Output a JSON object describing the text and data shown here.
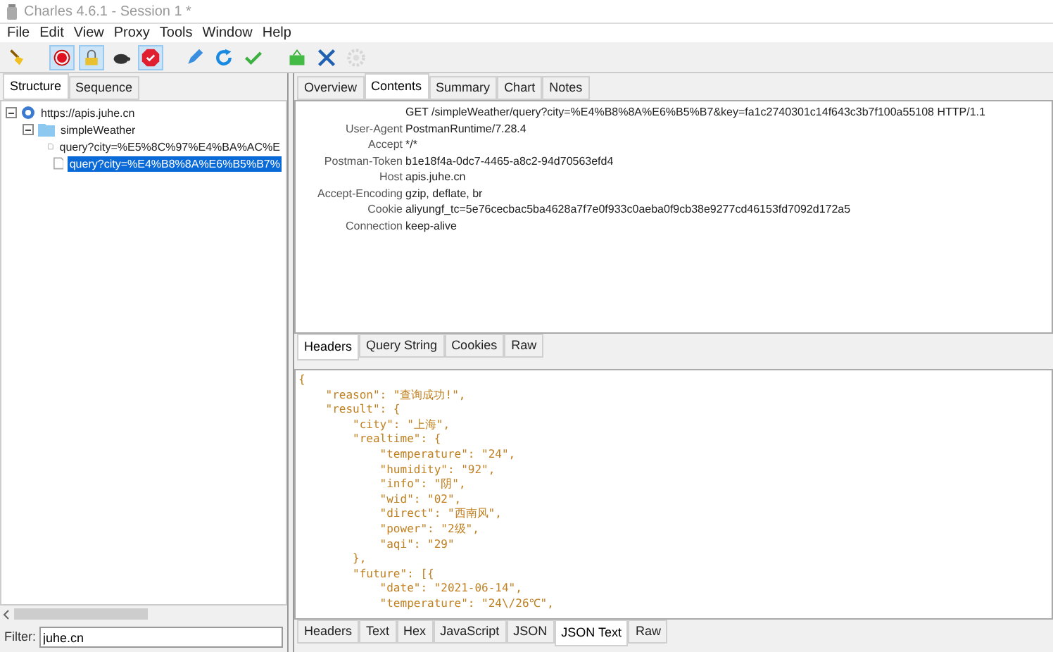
{
  "window": {
    "title": "Charles 4.6.1 - Session 1 *"
  },
  "menu": [
    "File",
    "Edit",
    "View",
    "Proxy",
    "Tools",
    "Window",
    "Help"
  ],
  "toolbar": [
    {
      "selected": false,
      "disabled": false
    },
    {
      "selected": true,
      "disabled": false
    },
    {
      "selected": true,
      "disabled": false
    },
    {
      "selected": false,
      "disabled": false
    },
    {
      "selected": true,
      "disabled": false
    },
    {
      "selected": false,
      "disabled": false
    },
    {
      "selected": false,
      "disabled": false
    },
    {
      "selected": false,
      "disabled": false
    },
    {
      "selected": false,
      "disabled": false
    },
    {
      "selected": false,
      "disabled": false
    },
    {
      "selected": false,
      "disabled": true
    }
  ],
  "left_tabs": [
    {
      "label": "Structure",
      "selected": true
    },
    {
      "label": "Sequence",
      "selected": false
    }
  ],
  "tree": [
    {
      "label": "https://apis.juhe.cn",
      "kind": "host",
      "expanded": true,
      "selected": false,
      "children": [
        {
          "label": "simpleWeather",
          "kind": "folder",
          "expanded": true,
          "selected": false,
          "children": [
            {
              "label": "query?city=%E5%8C%97%E4%BA%AC%E",
              "kind": "file",
              "selected": false
            },
            {
              "label": "query?city=%E4%B8%8A%E6%B5%B7%",
              "kind": "file",
              "selected": true
            }
          ]
        }
      ]
    }
  ],
  "filter": {
    "label": "Filter:",
    "value": "juhe.cn"
  },
  "right_tabs": [
    {
      "label": "Overview",
      "selected": false
    },
    {
      "label": "Contents",
      "selected": true
    },
    {
      "label": "Summary",
      "selected": false
    },
    {
      "label": "Chart",
      "selected": false
    },
    {
      "label": "Notes",
      "selected": false
    }
  ],
  "headers": [
    {
      "value": "GET /simpleWeather/query?city=%E4%B8%8A%E6%B5%B7&key=fa1c2740301c14f643c3b7f100a55108 HTTP/1.1"
    },
    {
      "name": "User-Agent",
      "value": "PostmanRuntime/7.28.4"
    },
    {
      "name": "Accept",
      "value": "*/*"
    },
    {
      "name": "Postman-Token",
      "value": "b1e18f4a-0dc7-4465-a8c2-94d70563efd4"
    },
    {
      "name": "Host",
      "value": "apis.juhe.cn"
    },
    {
      "name": "Accept-Encoding",
      "value": "gzip, deflate, br"
    },
    {
      "name": "Cookie",
      "value": "aliyungf_tc=5e76cecbac5ba4628a7f7e0f933c0aeba0f9cb38e9277cd46153fd7092d172a5"
    },
    {
      "name": "Connection",
      "value": "keep-alive"
    }
  ],
  "request_tabs": [
    {
      "label": "Headers",
      "selected": true
    },
    {
      "label": "Query String",
      "selected": false
    },
    {
      "label": "Cookies",
      "selected": false
    },
    {
      "label": "Raw",
      "selected": false
    }
  ],
  "json_lines": [
    "{",
    "    \"reason\": \"查询成功!\",",
    "    \"result\": {",
    "        \"city\": \"上海\",",
    "        \"realtime\": {",
    "            \"temperature\": \"24\",",
    "            \"humidity\": \"92\",",
    "            \"info\": \"阴\",",
    "            \"wid\": \"02\",",
    "            \"direct\": \"西南风\",",
    "            \"power\": \"2级\",",
    "            \"aqi\": \"29\"",
    "        },",
    "        \"future\": [{",
    "            \"date\": \"2021-06-14\",",
    "            \"temperature\": \"24\\/26℃\","
  ],
  "response_tabs": [
    {
      "label": "Headers",
      "selected": false
    },
    {
      "label": "Text",
      "selected": false
    },
    {
      "label": "Hex",
      "selected": false
    },
    {
      "label": "JavaScript",
      "selected": false
    },
    {
      "label": "JSON",
      "selected": false
    },
    {
      "label": "JSON Text",
      "selected": true
    },
    {
      "label": "Raw",
      "selected": false
    }
  ]
}
